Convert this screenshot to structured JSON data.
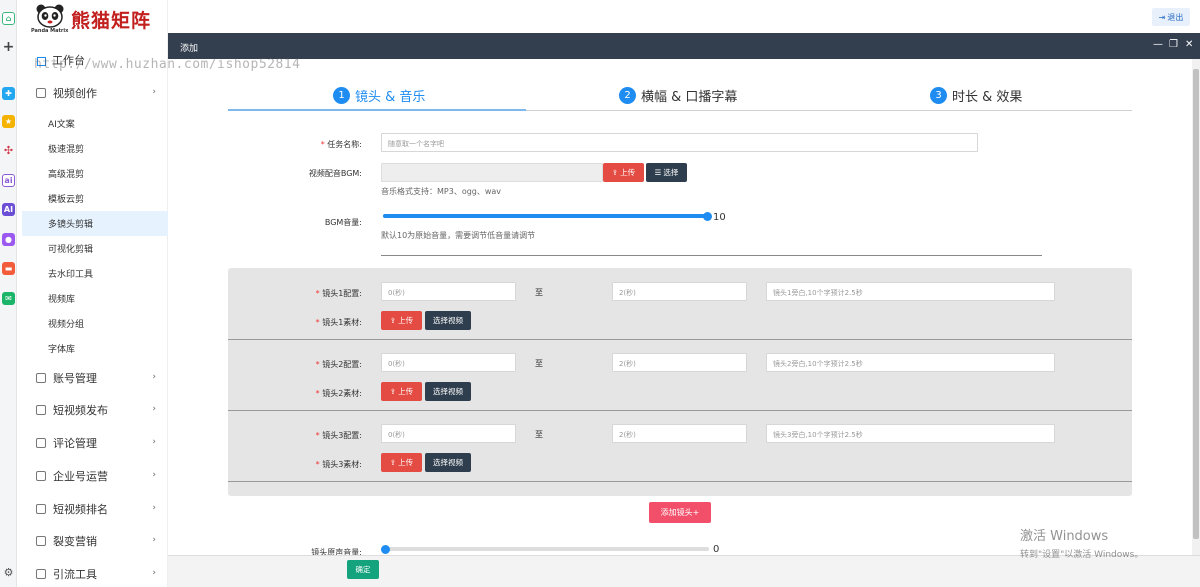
{
  "brand": {
    "name": "熊猫矩阵",
    "sub": "Panda Matrix"
  },
  "watermark": "http://www.huzhan.com/ishop52814",
  "sidebar": {
    "workbench": "工作台",
    "video_creation": "视频创作",
    "sub_items": [
      "AI文案",
      "极速混剪",
      "高级混剪",
      "模板云剪",
      "多镜头剪辑",
      "可视化剪辑",
      "去水印工具",
      "视频库",
      "视频分组",
      "字体库"
    ],
    "active_sub": "多镜头剪辑",
    "groups": [
      "账号管理",
      "短视频发布",
      "评论管理",
      "企业号运营",
      "短视频排名",
      "裂变营销",
      "引流工具"
    ]
  },
  "topbar": {
    "logout": "退出"
  },
  "dialog": {
    "title": "添加",
    "steps": [
      {
        "num": "1",
        "label": "镜头 & 音乐"
      },
      {
        "num": "2",
        "label": "横幅 & 口播字幕"
      },
      {
        "num": "3",
        "label": "时长 & 效果"
      }
    ],
    "task_name_label": "任务名称:",
    "task_name_placeholder": "随意取一个名字吧",
    "bgm_label": "视频配音BGM:",
    "upload_label": "上传",
    "choose_label": "选择",
    "bgm_hint": "音乐格式支持：MP3、ogg、wav",
    "bgm_volume_label": "BGM音量:",
    "bgm_volume_value": "10",
    "bgm_volume_level": 1.0,
    "bgm_volume_hint": "默认10为原始音量，需要调节低音量请调节",
    "shots": [
      {
        "config_label": "镜头1配置:",
        "start_placeholder": "0(秒)",
        "to": "至",
        "end_placeholder": "2(秒)",
        "narration_placeholder": "镜头1旁白,10个字预计2.5秒",
        "material_label": "镜头1素材:",
        "upload": "上传",
        "choose_video": "选择视频"
      },
      {
        "config_label": "镜头2配置:",
        "start_placeholder": "0(秒)",
        "to": "至",
        "end_placeholder": "2(秒)",
        "narration_placeholder": "镜头2旁白,10个字预计2.5秒",
        "material_label": "镜头2素材:",
        "upload": "上传",
        "choose_video": "选择视频"
      },
      {
        "config_label": "镜头3配置:",
        "start_placeholder": "0(秒)",
        "to": "至",
        "end_placeholder": "2(秒)",
        "narration_placeholder": "镜头3旁白,10个字预计2.5秒",
        "material_label": "镜头3素材:",
        "upload": "上传",
        "choose_video": "选择视频"
      }
    ],
    "add_shot": "添加镜头+",
    "orig_volume_label": "镜头原声音量:",
    "orig_volume_value": "0",
    "orig_volume_level": 0.0,
    "confirm": "确定"
  },
  "windows_activation": {
    "line1": "激活 Windows",
    "line2": "转到\"设置\"以激活 Windows。"
  },
  "colors": {
    "accent": "#1e8cf0",
    "danger": "#e44c43",
    "dark": "#2f3e4e",
    "header": "#333f4f",
    "confirm": "#14a37d",
    "add": "#f2506a"
  }
}
